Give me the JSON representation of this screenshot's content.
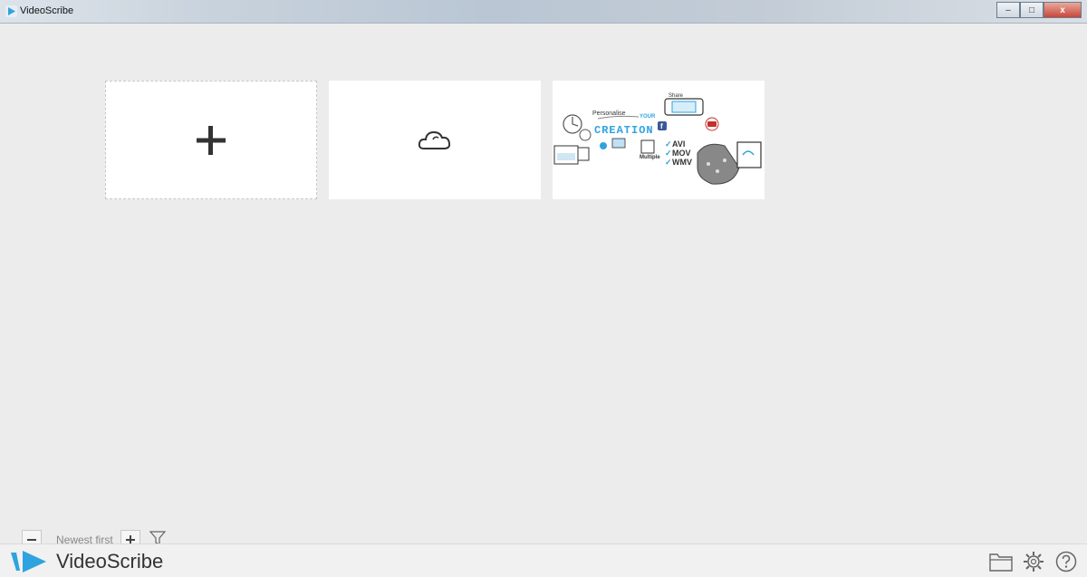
{
  "window": {
    "title": "VideoScribe",
    "controls": {
      "minimize": "–",
      "maximize": "□",
      "close": "x"
    }
  },
  "gallery": {
    "tiles": [
      {
        "kind": "new-scribe",
        "icon": "plus-icon"
      },
      {
        "kind": "open-cloud",
        "icon": "cloud-icon"
      },
      {
        "kind": "project",
        "thumbnail_text": {
          "personalise": "Personalise",
          "your": "YOUR",
          "creation": "CREATION",
          "share": "Share",
          "multiple": "Multiple",
          "formats": [
            "AVI",
            "MOV",
            "WMV"
          ]
        }
      }
    ]
  },
  "sortbar": {
    "label": "Newest first",
    "decrease_icon": "minus-icon",
    "increase_icon": "plus-icon",
    "filter_icon": "funnel-icon"
  },
  "footer": {
    "brand": "VideoScribe",
    "icons": [
      "folder-icon",
      "settings-gear-icon",
      "help-icon"
    ]
  },
  "colors": {
    "accent_blue": "#2ea3df",
    "background": "#ececec",
    "tile": "#ffffff"
  }
}
